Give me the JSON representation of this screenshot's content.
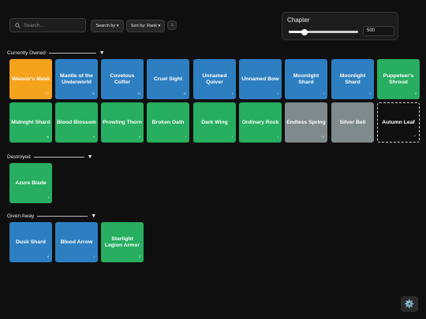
{
  "search": {
    "placeholder": "Search..."
  },
  "toolbar": {
    "search_by": "Search by ▾",
    "sort_by": "Sort by: Rank ▾",
    "sort_dir": "↓"
  },
  "chapter": {
    "label": "Chapter",
    "value": "500",
    "slider_fraction": 0.23
  },
  "colors": {
    "blue": "#2e7fc1",
    "green": "#27ae60",
    "orange": "#f5a21d",
    "gray": "#7f8a8c",
    "empty_border": "#cfcfcf"
  },
  "sections": [
    {
      "title": "Currently Owned",
      "collapse_icon": "▼",
      "cards": [
        {
          "name": "Weaver's Mask",
          "rank": "VII",
          "color": "orange"
        },
        {
          "name": "Mantle of the Underworld",
          "rank": "VI",
          "color": "blue"
        },
        {
          "name": "Covetous Coffer",
          "rank": "IV",
          "color": "blue"
        },
        {
          "name": "Cruel Sight",
          "rank": "IV",
          "color": "blue"
        },
        {
          "name": "Unnamed Quiver",
          "rank": "I",
          "color": "blue"
        },
        {
          "name": "Unnamed Bow",
          "rank": "I",
          "color": "blue"
        },
        {
          "name": "Moonlight Shard",
          "rank": "I",
          "color": "blue"
        },
        {
          "name": "Moonlight Shard",
          "rank": "I",
          "color": "blue"
        },
        {
          "name": "Puppeteer's Shroud",
          "rank": "V",
          "color": "green"
        },
        {
          "name": "Midnight Shard",
          "rank": "III",
          "color": "green"
        },
        {
          "name": "Blood Blossom",
          "rank": "II",
          "color": "green"
        },
        {
          "name": "Prowling Thorn",
          "rank": "II",
          "color": "green"
        },
        {
          "name": "Broken Oath",
          "rank": "I",
          "color": "green"
        },
        {
          "name": "Dark Wing",
          "rank": "I",
          "color": "green"
        },
        {
          "name": "Ordinary Rock",
          "rank": "I",
          "color": "green"
        },
        {
          "name": "Endless Spring",
          "rank": "IV",
          "color": "gray"
        },
        {
          "name": "Silver Bell",
          "rank": "I",
          "color": "gray"
        },
        {
          "name": "Autumn Leaf",
          "rank": "Y",
          "color": "empty"
        }
      ]
    },
    {
      "title": "Destroyed",
      "collapse_icon": "▼",
      "cards": [
        {
          "name": "Azure Blade",
          "rank": "I",
          "color": "green"
        }
      ]
    },
    {
      "title": "Given Away",
      "collapse_icon": "▼",
      "cards": [
        {
          "name": "Dusk Shard",
          "rank": "II",
          "color": "blue"
        },
        {
          "name": "Blood Arrow",
          "rank": "I",
          "color": "blue"
        },
        {
          "name": "Starlight Legion Armor",
          "rank": "II",
          "color": "green"
        }
      ]
    }
  ],
  "settings": {
    "icon": "gear-icon",
    "glyph": "⚙️"
  }
}
